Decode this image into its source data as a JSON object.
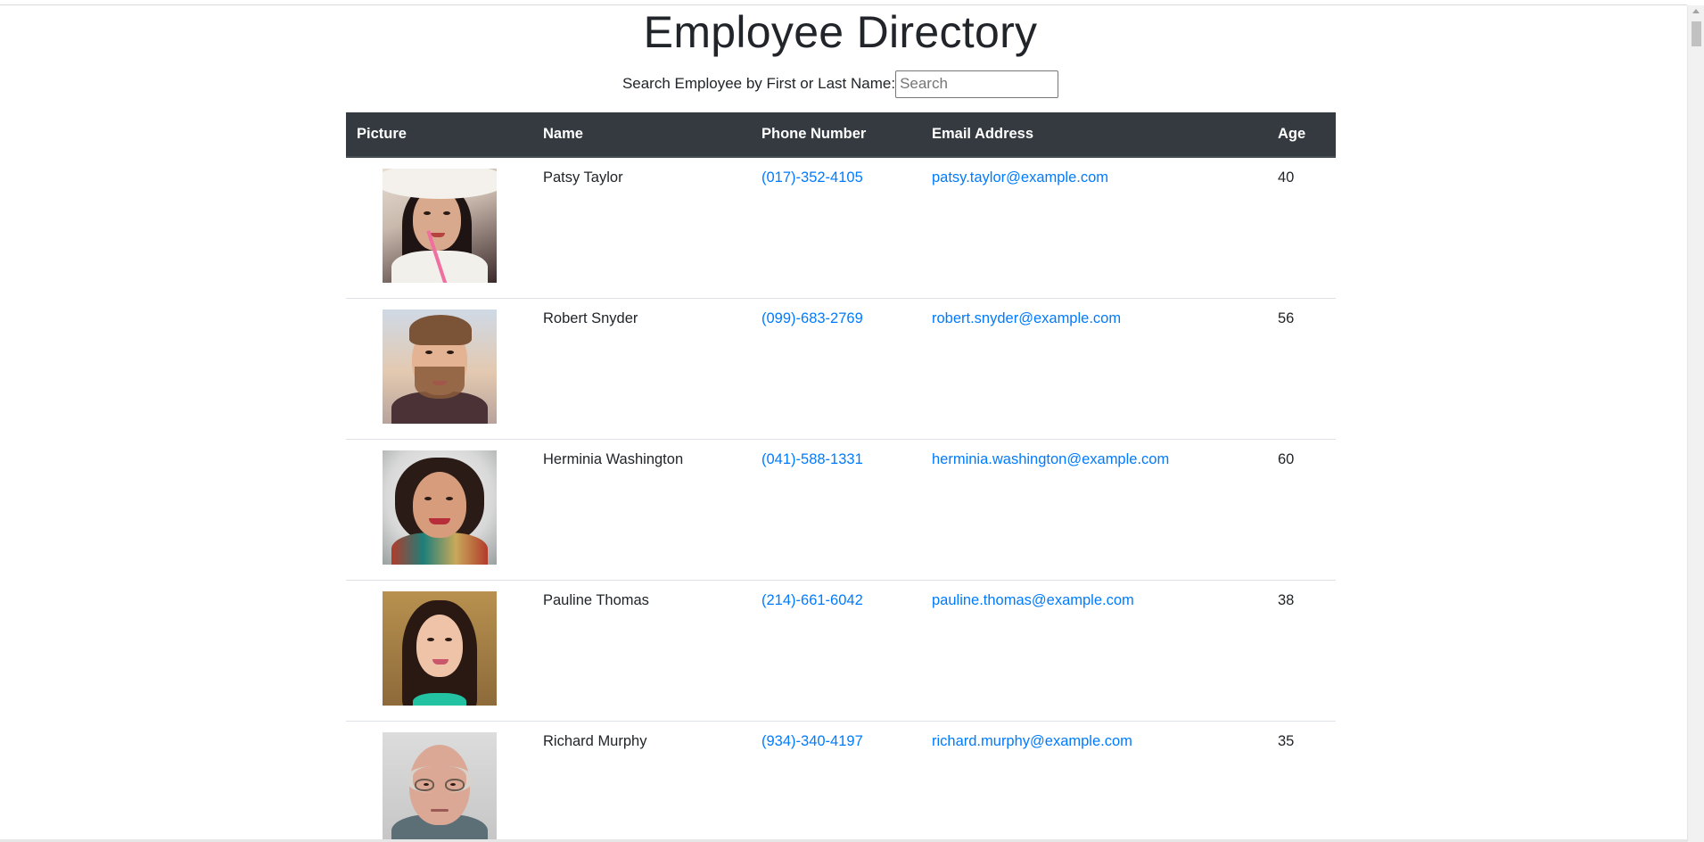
{
  "page": {
    "title": "Employee Directory"
  },
  "search": {
    "label": "Search Employee by First or Last Name:",
    "placeholder": "Search",
    "value": ""
  },
  "table": {
    "headers": {
      "picture": "Picture",
      "name": "Name",
      "phone": "Phone Number",
      "email": "Email Address",
      "age": "Age"
    },
    "rows": [
      {
        "name": "Patsy Taylor",
        "phone": "(017)-352-4105",
        "email": "patsy.taylor@example.com",
        "age": "40",
        "avatar": "woman-white-hat-photo"
      },
      {
        "name": "Robert Snyder",
        "phone": "(099)-683-2769",
        "email": "robert.snyder@example.com",
        "age": "56",
        "avatar": "bearded-man-photo"
      },
      {
        "name": "Herminia Washington",
        "phone": "(041)-588-1331",
        "email": "herminia.washington@example.com",
        "age": "60",
        "avatar": "smiling-woman-scarf-photo"
      },
      {
        "name": "Pauline Thomas",
        "phone": "(214)-661-6042",
        "email": "pauline.thomas@example.com",
        "age": "38",
        "avatar": "brunette-woman-photo"
      },
      {
        "name": "Richard Murphy",
        "phone": "(934)-340-4197",
        "email": "richard.murphy@example.com",
        "age": "35",
        "avatar": "bald-man-glasses-photo"
      }
    ]
  },
  "colors": {
    "header_bg": "#343a40",
    "link": "#007bff",
    "text": "#212529",
    "row_divider": "#dee2e6"
  }
}
